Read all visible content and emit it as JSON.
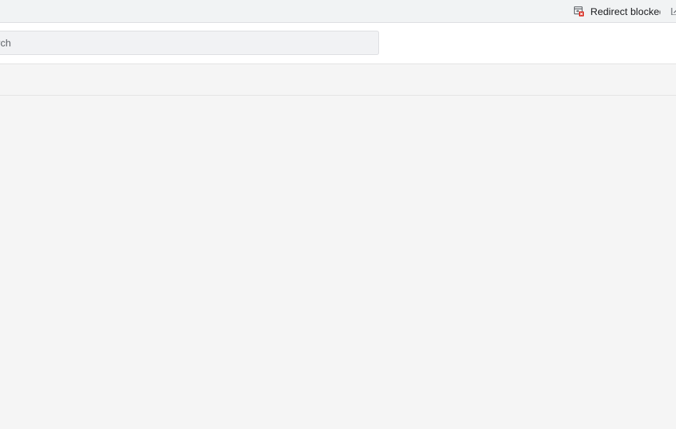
{
  "browser_bar": {
    "redirect_indicator": {
      "label": "Redirect blocked",
      "icon": "redirect-blocked-icon"
    },
    "extra_icon": "open-in-new-icon"
  },
  "header": {
    "search": {
      "placeholder": "Search",
      "value": ""
    }
  },
  "colors": {
    "page_background": "#f5f5f5",
    "header_background": "#ffffff",
    "search_background": "#f1f2f4",
    "blocked_badge": "#d93025"
  }
}
